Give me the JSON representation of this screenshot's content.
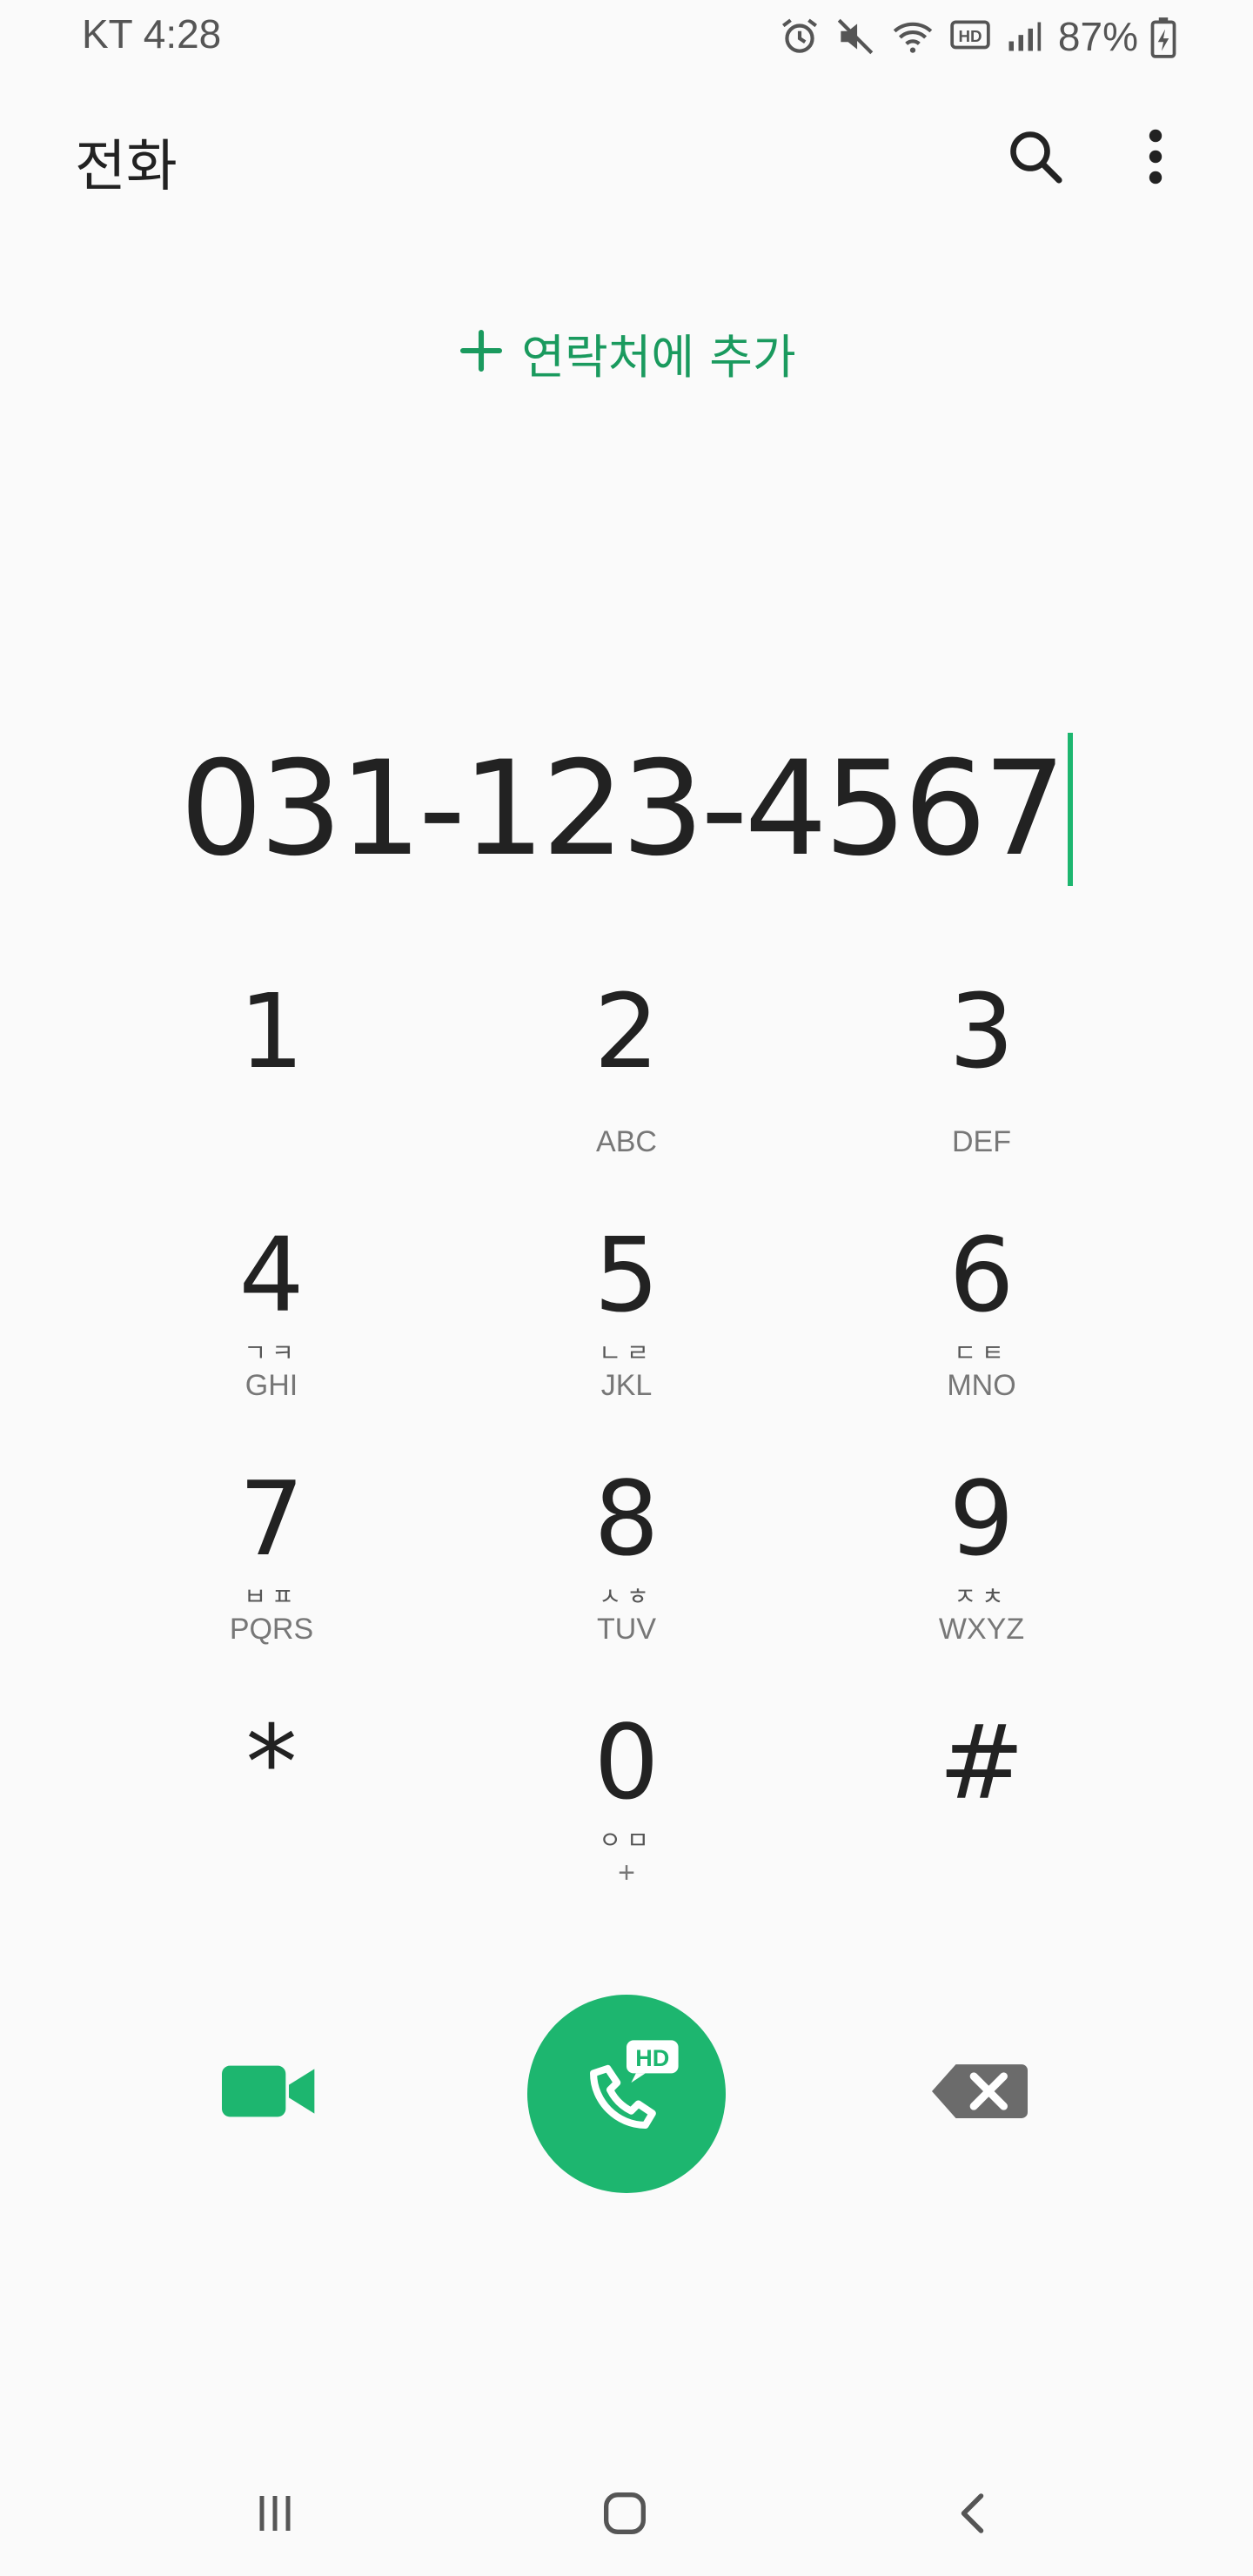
{
  "status_bar": {
    "carrier_time": "KT 4:28",
    "battery_percent": "87%",
    "icons": [
      "alarm-icon",
      "mute-icon",
      "wifi-icon",
      "hd-voice-icon",
      "signal-icon",
      "battery-charging-icon"
    ]
  },
  "app_bar": {
    "title": "전화",
    "icons": [
      "search-icon",
      "more-options-icon"
    ]
  },
  "add_contact": {
    "label": "연락처에 추가",
    "icon": "plus-icon"
  },
  "dialed_number": "031-123-4567",
  "keypad": [
    {
      "digit": "1",
      "korean": "",
      "letters": ""
    },
    {
      "digit": "2",
      "korean": "",
      "letters": "ABC"
    },
    {
      "digit": "3",
      "korean": "",
      "letters": "DEF"
    },
    {
      "digit": "4",
      "korean": "ㄱㅋ",
      "letters": "GHI"
    },
    {
      "digit": "5",
      "korean": "ㄴㄹ",
      "letters": "JKL"
    },
    {
      "digit": "6",
      "korean": "ㄷㅌ",
      "letters": "MNO"
    },
    {
      "digit": "7",
      "korean": "ㅂㅍ",
      "letters": "PQRS"
    },
    {
      "digit": "8",
      "korean": "ㅅㅎ",
      "letters": "TUV"
    },
    {
      "digit": "9",
      "korean": "ㅈㅊ",
      "letters": "WXYZ"
    },
    {
      "digit": "*",
      "korean": "",
      "letters": ""
    },
    {
      "digit": "0",
      "korean": "ㅇㅁ",
      "letters": "+"
    },
    {
      "digit": "#",
      "korean": "",
      "letters": ""
    }
  ],
  "actions": {
    "call_badge": "HD",
    "icons": [
      "video-call-icon",
      "hd-call-icon",
      "backspace-icon"
    ]
  },
  "colors": {
    "accent": "#1db66f",
    "accent_text": "#1a9a5e",
    "background": "#fafafa",
    "text": "#222222",
    "backspace": "#6b6b6b"
  },
  "nav_bar": {
    "icons": [
      "recent-apps-icon",
      "home-icon",
      "back-icon"
    ]
  }
}
